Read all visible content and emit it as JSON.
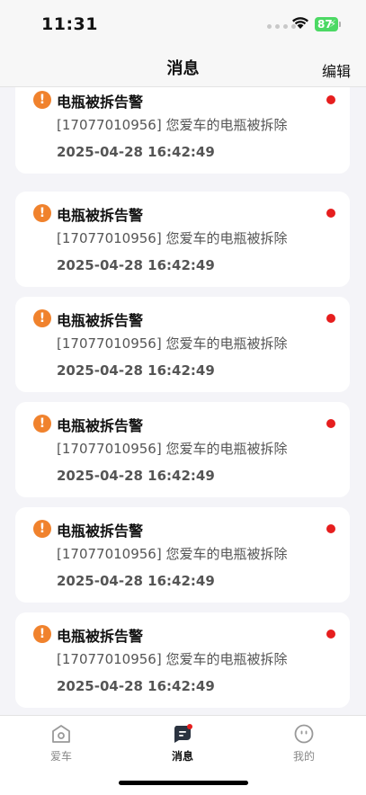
{
  "status_bar": {
    "time": "11:31",
    "battery": "87"
  },
  "nav": {
    "title": "消息",
    "edit_label": "编辑"
  },
  "messages": [
    {
      "title": "电瓶被拆告警",
      "body": "[17077010956] 您爱车的电瓶被拆除",
      "time": "2025-04-28 16:42:49"
    },
    {
      "title": "电瓶被拆告警",
      "body": "[17077010956] 您爱车的电瓶被拆除",
      "time": "2025-04-28 16:42:49"
    },
    {
      "title": "电瓶被拆告警",
      "body": "[17077010956] 您爱车的电瓶被拆除",
      "time": "2025-04-28 16:42:49"
    },
    {
      "title": "电瓶被拆告警",
      "body": "[17077010956] 您爱车的电瓶被拆除",
      "time": "2025-04-28 16:42:49"
    },
    {
      "title": "电瓶被拆告警",
      "body": "[17077010956] 您爱车的电瓶被拆除",
      "time": "2025-04-28 16:42:49"
    },
    {
      "title": "电瓶被拆告警",
      "body": "[17077010956] 您爱车的电瓶被拆除",
      "time": "2025-04-28 16:42:49"
    }
  ],
  "tabs": [
    {
      "label": "爱车",
      "icon": "car-garage-icon"
    },
    {
      "label": "消息",
      "icon": "message-icon"
    },
    {
      "label": "我的",
      "icon": "profile-face-icon"
    }
  ],
  "colors": {
    "alert": "#f0822d",
    "unread": "#e61e1e",
    "battery": "#4cd964"
  }
}
